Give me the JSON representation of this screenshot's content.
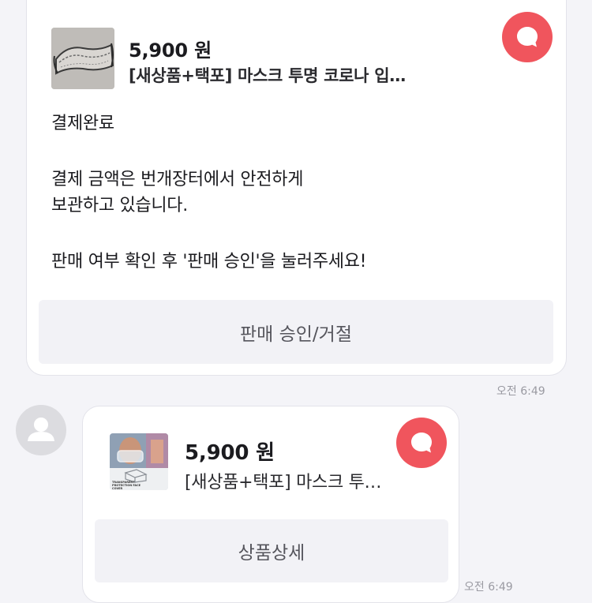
{
  "messages": [
    {
      "price": "5,900",
      "currency": "원",
      "product_name": "[새상품+택포] 마스크 투명 코로나 입…",
      "lines": [
        "결제완료",
        "",
        "결제 금액은 번개장터에서 안전하게",
        "보관하고 있습니다.",
        "",
        "판매 여부 확인 후 '판매 승인'을 눌러주세요!"
      ],
      "button_label": "판매 승인/거절",
      "time": "오전 6:49"
    },
    {
      "price": "5,900",
      "currency": "원",
      "product_name": "[새상품+택포] 마스크 투…",
      "thumb_caption": "TRANSPARENT PROTECTION FACE COVER",
      "button_label": "상품상세",
      "time": "오전 6:49"
    }
  ],
  "colors": {
    "accent": "#f0555d",
    "background": "#f4f4f8",
    "button_bg": "#f2f2f6"
  },
  "icons": {
    "badge": "chat-bubble-icon",
    "avatar": "default-user-icon"
  }
}
